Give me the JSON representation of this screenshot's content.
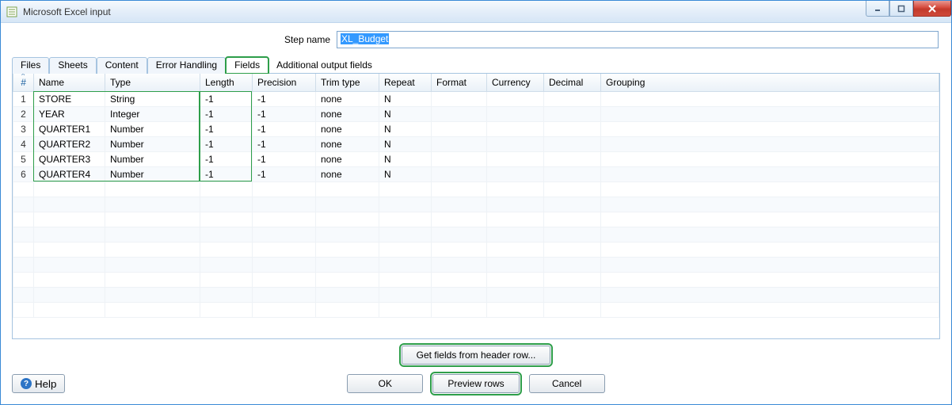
{
  "window": {
    "title": "Microsoft Excel input"
  },
  "step": {
    "label": "Step name",
    "value": "XL_Budget"
  },
  "tabs": {
    "items": [
      "Files",
      "Sheets",
      "Content",
      "Error Handling",
      "Fields",
      "Additional output fields"
    ],
    "active_index": 4
  },
  "grid": {
    "headers": [
      "#",
      "Name",
      "Type",
      "Length",
      "Precision",
      "Trim type",
      "Repeat",
      "Format",
      "Currency",
      "Decimal",
      "Grouping"
    ],
    "rows": [
      {
        "n": "1",
        "name": "STORE",
        "type": "String",
        "length": "-1",
        "precision": "-1",
        "trim": "none",
        "repeat": "N",
        "format": "",
        "currency": "",
        "decimal": "",
        "grouping": ""
      },
      {
        "n": "2",
        "name": "YEAR",
        "type": "Integer",
        "length": "-1",
        "precision": "-1",
        "trim": "none",
        "repeat": "N",
        "format": "",
        "currency": "",
        "decimal": "",
        "grouping": ""
      },
      {
        "n": "3",
        "name": "QUARTER1",
        "type": "Number",
        "length": "-1",
        "precision": "-1",
        "trim": "none",
        "repeat": "N",
        "format": "",
        "currency": "",
        "decimal": "",
        "grouping": ""
      },
      {
        "n": "4",
        "name": "QUARTER2",
        "type": "Number",
        "length": "-1",
        "precision": "-1",
        "trim": "none",
        "repeat": "N",
        "format": "",
        "currency": "",
        "decimal": "",
        "grouping": ""
      },
      {
        "n": "5",
        "name": "QUARTER3",
        "type": "Number",
        "length": "-1",
        "precision": "-1",
        "trim": "none",
        "repeat": "N",
        "format": "",
        "currency": "",
        "decimal": "",
        "grouping": ""
      },
      {
        "n": "6",
        "name": "QUARTER4",
        "type": "Number",
        "length": "-1",
        "precision": "-1",
        "trim": "none",
        "repeat": "N",
        "format": "",
        "currency": "",
        "decimal": "",
        "grouping": ""
      }
    ],
    "empty_rows": 9
  },
  "buttons": {
    "get_fields": "Get fields from header row...",
    "ok": "OK",
    "preview": "Preview rows",
    "cancel": "Cancel",
    "help": "Help"
  }
}
